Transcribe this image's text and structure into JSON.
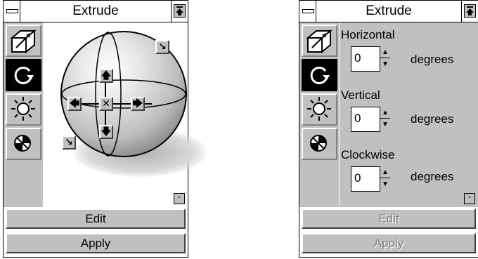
{
  "panel_left": {
    "title": "Extrude",
    "viewer_arrows": {
      "up": "🡅",
      "down": "🡇",
      "left": "🡄",
      "right": "🡆",
      "center": "✕",
      "ne": "↘",
      "sw": "↘"
    },
    "buttons": {
      "edit": "Edit",
      "apply": "Apply"
    }
  },
  "panel_right": {
    "title": "Extrude",
    "fields": [
      {
        "label": "Horizontal",
        "value": "0",
        "unit": "degrees"
      },
      {
        "label": "Vertical",
        "value": "0",
        "unit": "degrees"
      },
      {
        "label": "Clockwise",
        "value": "0",
        "unit": "degrees"
      }
    ],
    "buttons": {
      "edit": "Edit",
      "apply": "Apply"
    }
  },
  "tools": [
    "extrude-depth-icon",
    "rotation-icon",
    "lighting-icon",
    "color-wheel-icon"
  ],
  "colors": {
    "face": "#c0c0c0",
    "selected_tool": "#000000",
    "disabled_text": "#808080"
  }
}
